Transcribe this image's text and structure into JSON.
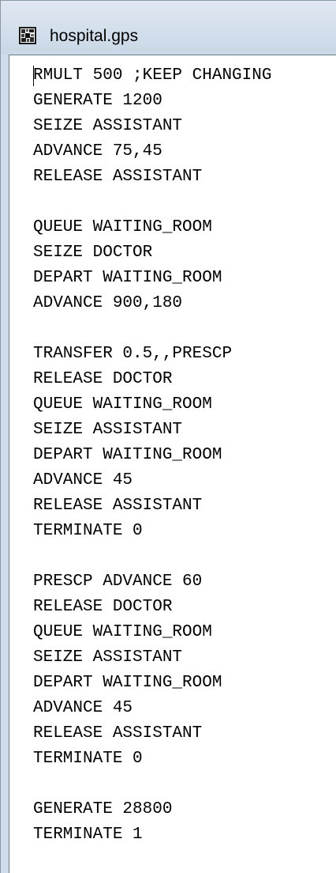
{
  "window": {
    "title": "hospital.gps",
    "icon": "gps-document-icon"
  },
  "editor": {
    "lines": [
      "RMULT 500 ;KEEP CHANGING",
      "GENERATE 1200",
      "SEIZE ASSISTANT",
      "ADVANCE 75,45",
      "RELEASE ASSISTANT",
      "",
      "QUEUE WAITING_ROOM",
      "SEIZE DOCTOR",
      "DEPART WAITING_ROOM",
      "ADVANCE 900,180",
      "",
      "TRANSFER 0.5,,PRESCP",
      "RELEASE DOCTOR",
      "QUEUE WAITING_ROOM",
      "SEIZE ASSISTANT",
      "DEPART WAITING_ROOM",
      "ADVANCE 45",
      "RELEASE ASSISTANT",
      "TERMINATE 0",
      "",
      "PRESCP ADVANCE 60",
      "RELEASE DOCTOR",
      "QUEUE WAITING_ROOM",
      "SEIZE ASSISTANT",
      "DEPART WAITING_ROOM",
      "ADVANCE 45",
      "RELEASE ASSISTANT",
      "TERMINATE 0",
      "",
      "GENERATE 28800",
      "TERMINATE 1"
    ]
  }
}
